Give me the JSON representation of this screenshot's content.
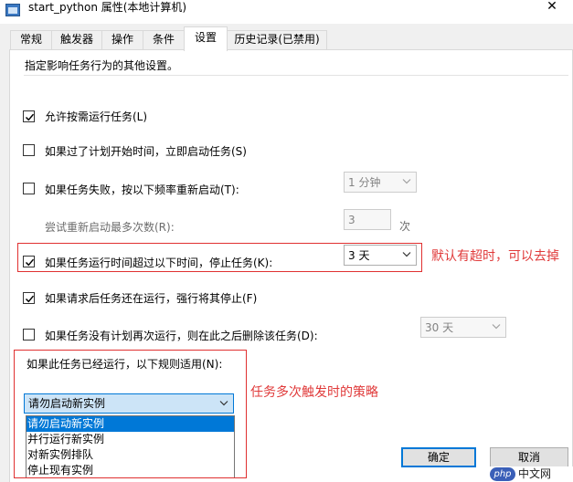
{
  "window": {
    "title": "start_python 属性(本地计算机)",
    "close_glyph": "✕"
  },
  "tabs": [
    {
      "label": "常规"
    },
    {
      "label": "触发器"
    },
    {
      "label": "操作"
    },
    {
      "label": "条件"
    },
    {
      "label": "设置",
      "active": true
    },
    {
      "label": "历史记录(已禁用)"
    }
  ],
  "settings": {
    "intro": "指定影响任务行为的其他设置。",
    "allow_on_demand": {
      "label": "允许按需运行任务(L)",
      "checked": true
    },
    "run_asap_if_missed": {
      "label": "如果过了计划开始时间，立即启动任务(S)",
      "checked": false
    },
    "restart_on_failure": {
      "label": "如果任务失败，按以下频率重新启动(T):",
      "checked": false,
      "interval": "1 分钟"
    },
    "retry": {
      "label": "尝试重新启动最多次数(R):",
      "value": "3",
      "unit": "次"
    },
    "stop_if_runs_longer": {
      "label": "如果任务运行时间超过以下时间，停止任务(K):",
      "checked": true,
      "duration": "3 天"
    },
    "force_stop": {
      "label": "如果请求后任务还在运行，强行将其停止(F)",
      "checked": true
    },
    "delete_if_not_scheduled": {
      "label": "如果任务没有计划再次运行，则在此之后删除该任务(D):",
      "checked": false,
      "after": "30 天"
    },
    "running_rule": {
      "label": "如果此任务已经运行，以下规则适用(N):",
      "selected": "请勿启动新实例",
      "options": [
        "请勿启动新实例",
        "并行运行新实例",
        "对新实例排队",
        "停止现有实例"
      ],
      "selected_index": 0
    }
  },
  "annotations": {
    "timeout_note": "默认有超时，可以去掉",
    "policy_note": "任务多次触发时的策略"
  },
  "buttons": {
    "ok": "确定",
    "cancel": "取消"
  },
  "watermark": {
    "badge": "php",
    "text": "中文网"
  },
  "colors": {
    "accent": "#0078d7",
    "annotation": "#e03030"
  }
}
